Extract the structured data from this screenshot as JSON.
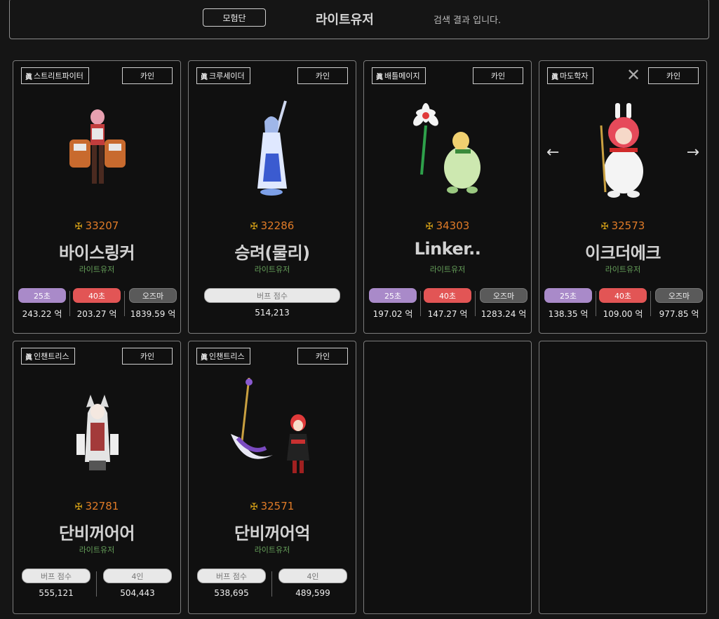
{
  "header": {
    "tab_label": "모험단",
    "search_name": "라이트유저",
    "search_msg": "검색 결과 입니다."
  },
  "common": {
    "jin_mark": "眞",
    "server_label": "카인",
    "close_glyph": "✕",
    "arrow_left": "←",
    "arrow_right": "→",
    "crest": "✠"
  },
  "cards": [
    {
      "job": "스트리트파이터",
      "fame": "33207",
      "name": "바이스링커",
      "guild": "라이트유저",
      "stats": [
        {
          "label": "25초",
          "value": "243.22 억",
          "color": "purple"
        },
        {
          "label": "40초",
          "value": "203.27 억",
          "color": "red"
        },
        {
          "label": "오즈마",
          "value": "1839.59 억",
          "color": "gray"
        }
      ]
    },
    {
      "job": "크루세이더",
      "fame": "32286",
      "name": "승려(물리)",
      "guild": "라이트유저",
      "buff_label": "버프 점수",
      "buff_value": "514,213"
    },
    {
      "job": "배틀메이지",
      "fame": "34303",
      "name": "Linker..",
      "guild": "라이트유저",
      "stats": [
        {
          "label": "25초",
          "value": "197.02 억",
          "color": "purple"
        },
        {
          "label": "40초",
          "value": "147.27 억",
          "color": "red"
        },
        {
          "label": "오즈마",
          "value": "1283.24 억",
          "color": "gray"
        }
      ]
    },
    {
      "job": "마도학자",
      "fame": "32573",
      "name": "이크더에크",
      "guild": "라이트유저",
      "stats": [
        {
          "label": "25초",
          "value": "138.35 억",
          "color": "purple"
        },
        {
          "label": "40초",
          "value": "109.00 억",
          "color": "red"
        },
        {
          "label": "오즈마",
          "value": "977.85 억",
          "color": "gray"
        }
      ]
    },
    {
      "job": "인챈트리스",
      "fame": "32781",
      "name": "단비꺼어어",
      "guild": "라이트유저",
      "buff_label": "버프 점수",
      "buff_value": "555,121",
      "party_label": "4인",
      "party_value": "504,443"
    },
    {
      "job": "인챈트리스",
      "fame": "32571",
      "name": "단비꺼어억",
      "guild": "라이트유저",
      "buff_label": "버프 점수",
      "buff_value": "538,695",
      "party_label": "4인",
      "party_value": "489,599"
    }
  ],
  "colors": {
    "fame": "#e07b27",
    "guild": "#66a05a",
    "purple": "#a98ac9",
    "red": "#e25555",
    "background": "#151515"
  }
}
